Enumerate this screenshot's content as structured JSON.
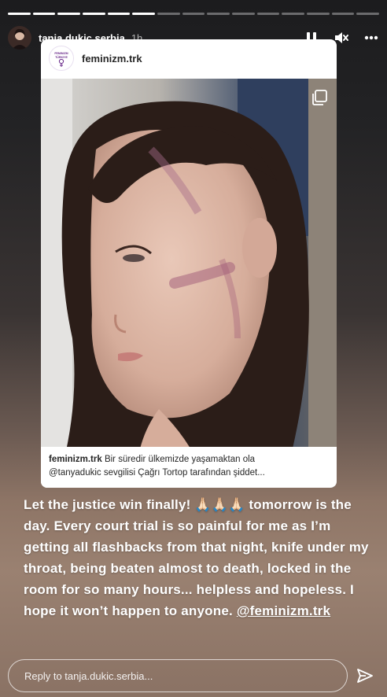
{
  "story": {
    "progress_total": 15,
    "progress_done": 6,
    "username": "tanja.dukic.serbia",
    "time_ago": "1h"
  },
  "icons": {
    "pause": "pause-icon",
    "mute": "speaker-muted-icon",
    "more": "more-horizontal-icon",
    "send": "send-icon",
    "multi": "carousel-icon"
  },
  "shared_post": {
    "username": "feminizm.trk",
    "logo_text_line1": "FEMINIZM",
    "logo_text_line2": "TÜRKIYE",
    "caption_user": "feminizm.trk",
    "caption_line1": "Bir süredir ülkemizde yaşamaktan ola",
    "caption_line2": "@tanyadukic sevgilisi Çağrı Tortop tarafından şiddet..."
  },
  "story_text": {
    "part1": "Let the justice win finally! 🙏🏻🙏🏻🙏🏻 tomorrow is the day. Every court trial is so painful for me as I’m getting all flashbacks from that night, knife under my throat, being beaten almost to death, locked in the room for so many hours... helpless and hopeless. I hope it won’t happen to anyone. ",
    "mention": "@feminizm.trk"
  },
  "reply": {
    "placeholder": "Reply to tanja.dukic.serbia..."
  }
}
